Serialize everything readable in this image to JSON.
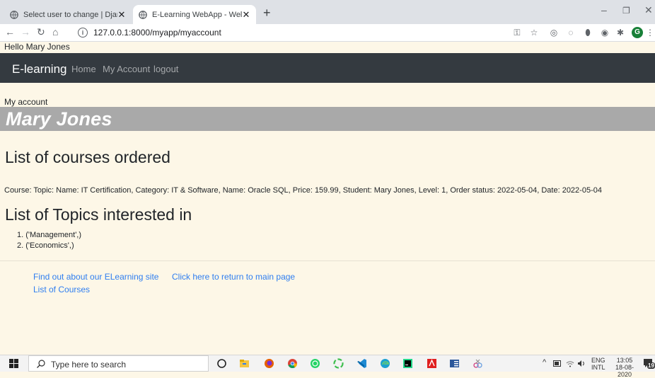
{
  "browser": {
    "tabs": [
      {
        "title": "Select user to change | Django site admin",
        "active": false
      },
      {
        "title": "E-Learning WebApp - Welcome!",
        "active": true
      }
    ],
    "url": "127.0.0.1:8000/myapp/myaccount",
    "profile_initial": "G"
  },
  "page": {
    "greeting": "Hello Mary Jones",
    "navbar": {
      "brand": "E-learning",
      "links": [
        "Home",
        "My Account",
        "logout"
      ]
    },
    "my_account_label": "My account",
    "user_name": "Mary Jones",
    "courses_heading": "List of courses ordered",
    "courses": [
      "Course: Topic: Name: IT Certification, Category: IT & Software, Name: Oracle SQL, Price: 159.99, Student: Mary Jones, Level: 1, Order status: 2022-05-04, Date: 2022-05-04"
    ],
    "topics_heading": "List of Topics interested in",
    "topics": [
      "1. ('Management',)",
      "2. ('Economics',)"
    ],
    "footer_links": {
      "about": "Find out about our ELearning site",
      "main": "Click here to return to main page",
      "courses": "List of Courses"
    }
  },
  "taskbar": {
    "search_placeholder": "Type here to search",
    "lang": "ENG",
    "lang_sub": "INTL",
    "time": "13:05",
    "date": "18-08-2020",
    "notification_count": "19"
  }
}
